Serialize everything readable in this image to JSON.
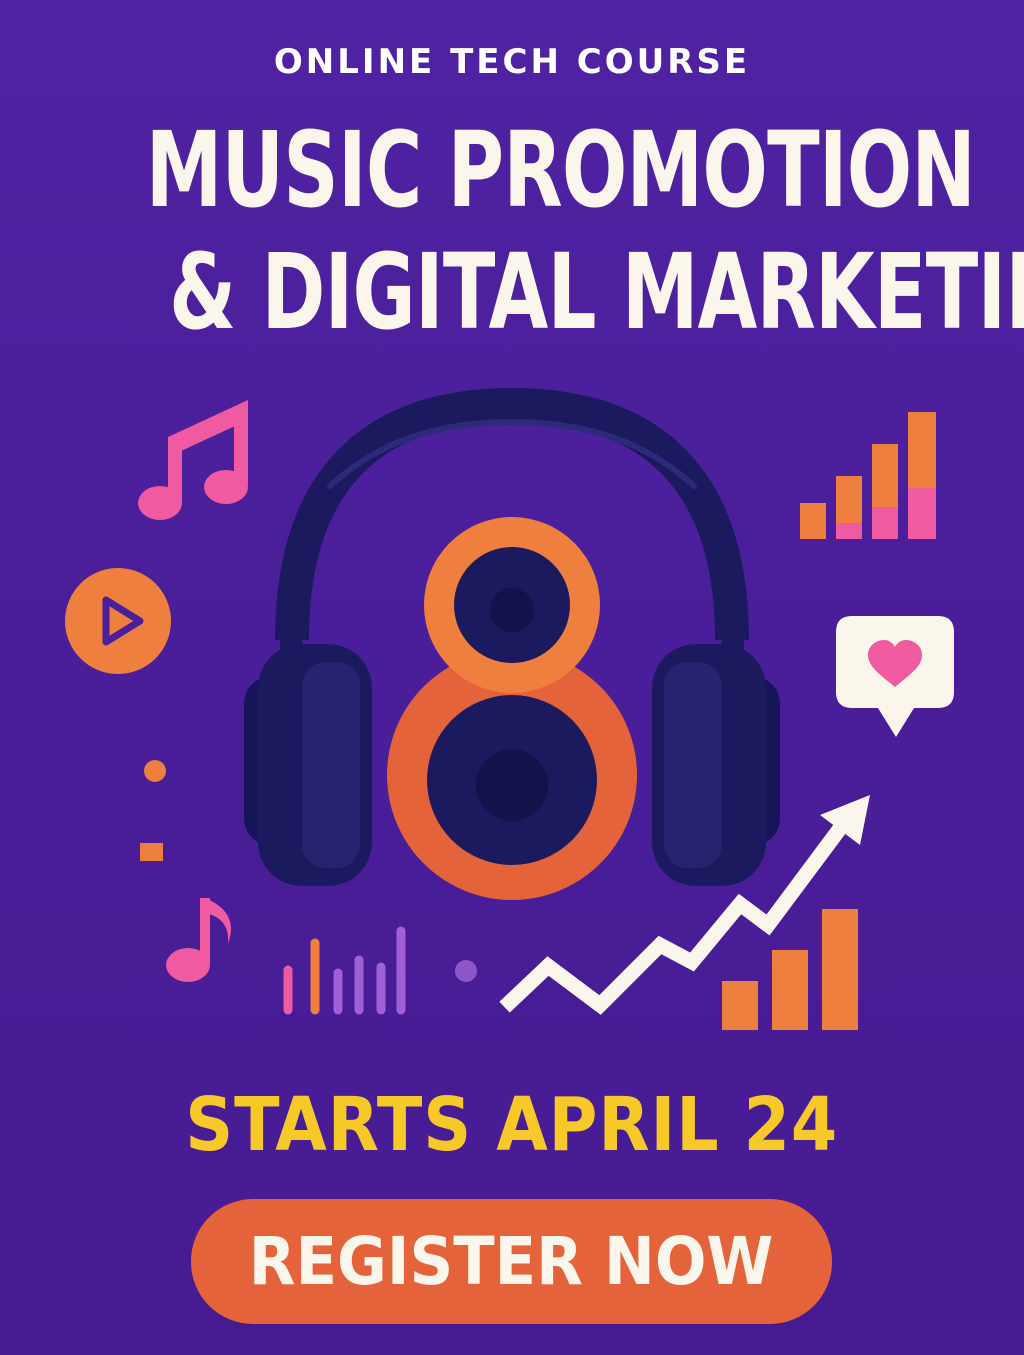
{
  "header": {
    "eyebrow": "ONLINE TECH COURSE",
    "title_line1": "MUSIC PROMOTION",
    "title_line2": "& DIGITAL MARKETING"
  },
  "event": {
    "start_text": "STARTS APRIL 24"
  },
  "cta": {
    "register_label": "REGISTER NOW"
  },
  "icons": [
    "music-note-icon",
    "play-button-icon",
    "headphones-icon",
    "speaker-icon",
    "bar-chart-icon",
    "heart-speech-bubble-icon",
    "trend-arrow-icon",
    "equalizer-icon",
    "small-music-note-icon"
  ],
  "colors": {
    "background": "#4b1f9c",
    "headline": "#fbf6ec",
    "accent_yellow": "#f7c928",
    "accent_orange": "#e4633a",
    "accent_pink": "#ef5aa0",
    "headphones_navy": "#1c1a5e"
  }
}
